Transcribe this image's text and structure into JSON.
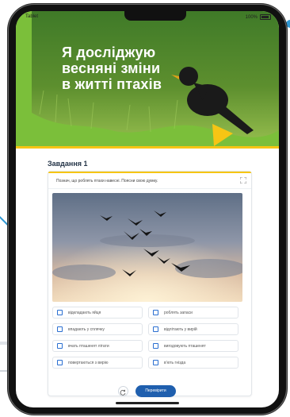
{
  "status": {
    "device": "Tablet",
    "battery": "100%"
  },
  "hero": {
    "title_lines": [
      "Я досліджую",
      "весняні зміни",
      "в житті птахів"
    ]
  },
  "task": {
    "title": "Завдання 1",
    "instruction": "Познач, що роблять птахи навесні. Поясни свою думку.",
    "photo_alt": "birds-in-sunset-sky",
    "options": [
      {
        "label": "відкладають яйця",
        "checked": false
      },
      {
        "label": "роблять запаси",
        "checked": false
      },
      {
        "label": "впадають у сплячку",
        "checked": false
      },
      {
        "label": "відлітають у вирій",
        "checked": false
      },
      {
        "label": "вчать пташенят літати",
        "checked": false
      },
      {
        "label": "вигодовують пташенят",
        "checked": false
      },
      {
        "label": "повертаються з вирію",
        "checked": false
      },
      {
        "label": "в'ють гнізда",
        "checked": false
      }
    ],
    "check_label": "Перевірити"
  },
  "colors": {
    "accent_blue": "#1f5fae",
    "hero_green": "#7bbf3a",
    "highlight_yellow": "#f6c514",
    "decor_blue": "#2f97d3"
  }
}
